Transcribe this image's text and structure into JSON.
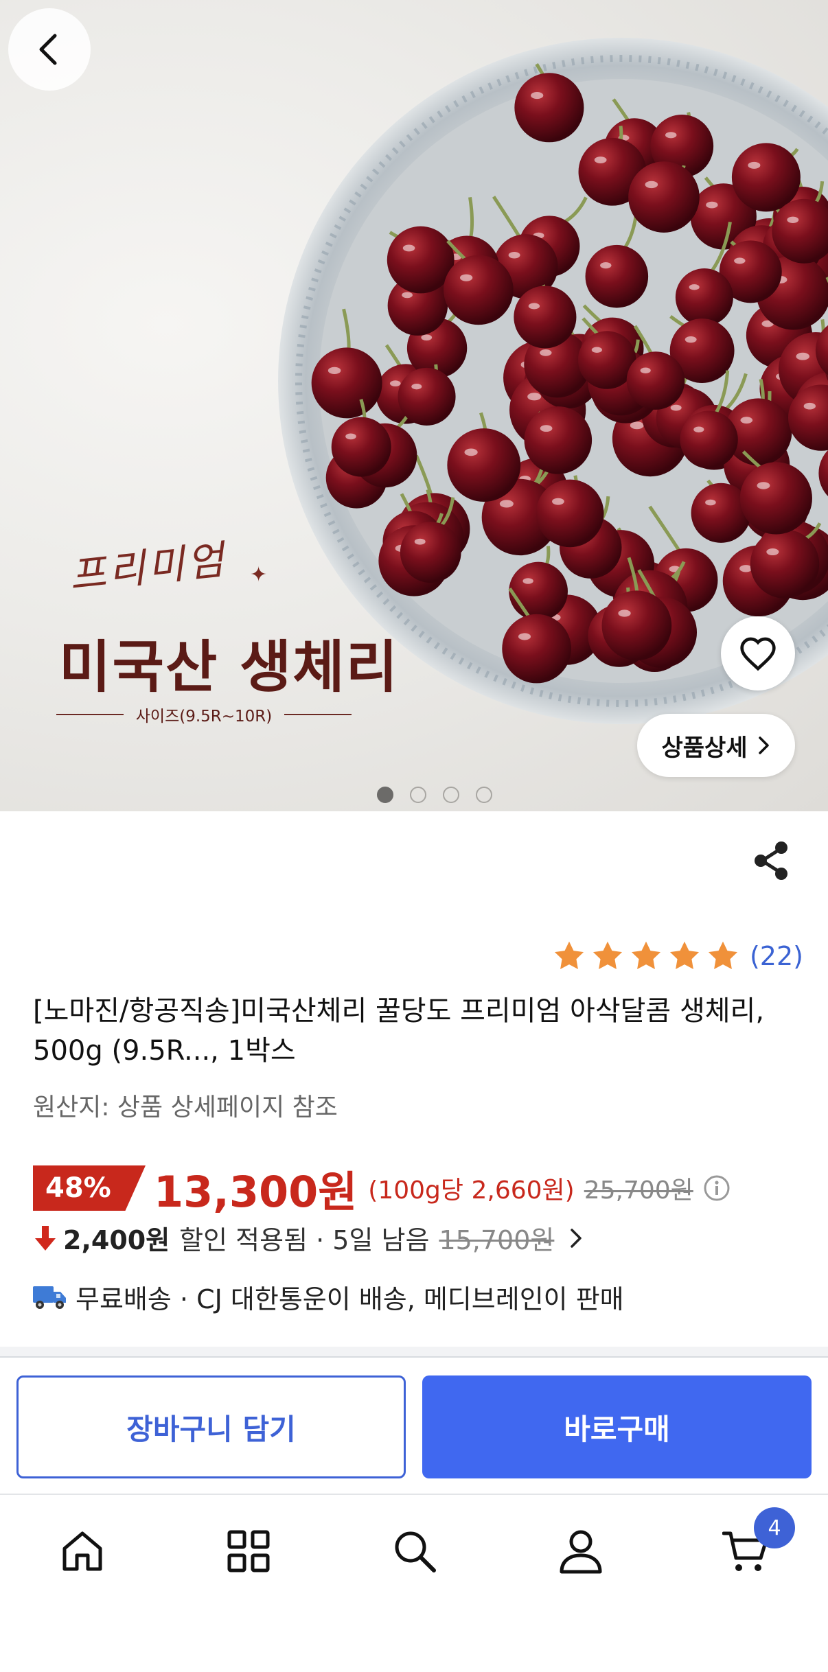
{
  "hero": {
    "promo_script": "프리미엄",
    "promo_title": "미국산 생체리",
    "promo_size": "사이즈(9.5R~10R)",
    "detail_button": "상품상세",
    "slide_count": 4,
    "active_slide": 1
  },
  "product": {
    "rating_stars": 5,
    "review_count": "(22)",
    "title": "[노마진/항공직송]미국산체리 꿀당도 프리미엄 아삭달콤 생체리, 500g (9.5R..., 1박스",
    "origin": "원산지: 상품 상세페이지 참조",
    "discount_rate": "48%",
    "price": "13,300원",
    "unit_price": "(100g당 2,660원)",
    "original_price": "25,700원",
    "coupon_amount": "2,400원",
    "coupon_text": "할인 적용됨 · 5일 남음",
    "coupon_old_price": "15,700원",
    "shipping": "무료배송 · CJ 대한통운이 배송, 메디브레인이 판매"
  },
  "actions": {
    "cart_label": "장바구니 담기",
    "buy_label": "바로구매"
  },
  "nav": {
    "items": [
      "home-icon",
      "categories-icon",
      "search-icon",
      "my-page-icon",
      "cart-icon"
    ],
    "cart_badge": "4"
  },
  "colors": {
    "accent_blue": "#4068f0",
    "sale_red": "#c8281c",
    "star_orange": "#f0913a",
    "promo_brown": "#5b1b16"
  }
}
